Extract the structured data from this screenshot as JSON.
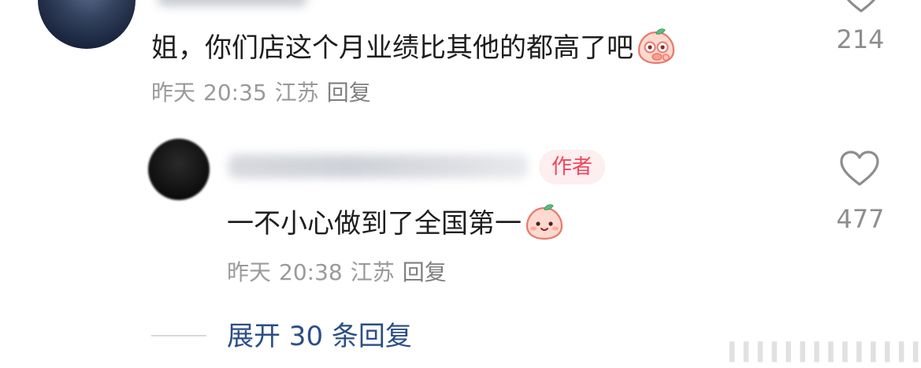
{
  "comments": [
    {
      "avatar_icon": "user-avatar",
      "username": "",
      "text": "姐，你们店这个月业绩比其他的都高了吧",
      "emoji_icon": "peach-emoji-surprised-icon",
      "date": "昨天",
      "time": "20:35",
      "location": "江苏",
      "reply_label": "回复",
      "like_count": "214",
      "like_icon": "heart-outline-icon"
    }
  ],
  "reply": {
    "avatar_icon": "author-avatar",
    "username": "",
    "author_badge": "作者",
    "text": "一不小心做到了全国第一",
    "emoji_icon": "peach-emoji-smile-icon",
    "date": "昨天",
    "time": "20:38",
    "location": "江苏",
    "reply_label": "回复",
    "like_count": "477",
    "like_icon": "heart-outline-icon"
  },
  "expand_replies_label": "展开 30 条回复",
  "colors": {
    "author_badge_text": "#f2465c",
    "author_badge_bg": "#fdeef0",
    "expand_link": "#2b4e86",
    "meta_text": "#9a9a9a",
    "like_count": "#8d8d8d"
  }
}
